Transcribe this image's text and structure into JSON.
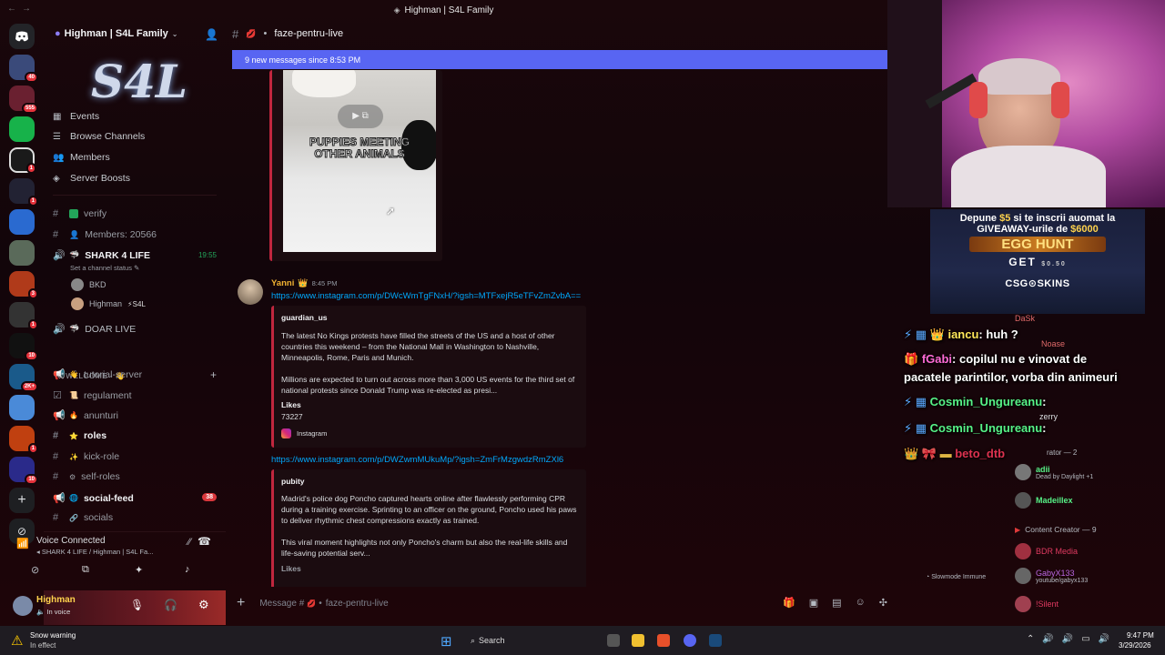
{
  "window": {
    "title": "Highman | S4L Family"
  },
  "server": {
    "name": "Highman | S4L Family",
    "logo_text": "S4L"
  },
  "rail_badges": [
    "40",
    "555",
    "1",
    "1",
    "3",
    "1",
    "10",
    "2K+",
    "1",
    "10"
  ],
  "menu": [
    {
      "label": "Events",
      "icon": "calendar-icon"
    },
    {
      "label": "Browse Channels",
      "icon": "browse-icon"
    },
    {
      "label": "Members",
      "icon": "members-icon"
    },
    {
      "label": "Server Boosts",
      "icon": "boost-icon"
    }
  ],
  "channels_top": [
    {
      "label": "verify",
      "icon": "hash-icon"
    },
    {
      "label": "Members: 20566",
      "icon": "hash-icon"
    }
  ],
  "voice_channel": {
    "name": "SHARK 4 LIFE",
    "timer": "19:55",
    "status_hint": "Set a channel status"
  },
  "voice_users": [
    {
      "name": "BKD"
    },
    {
      "name": "Highman",
      "tag": "S4L"
    }
  ],
  "doar_live": "DOAR LIVE",
  "category": "WELCOME - 👋",
  "channels": [
    {
      "label": "tutorial-server",
      "bold": false
    },
    {
      "label": "regulament",
      "bold": false
    },
    {
      "label": "anunturi",
      "bold": false
    },
    {
      "label": "roles",
      "bold": true
    },
    {
      "label": "kick-role",
      "bold": false
    },
    {
      "label": "self-roles",
      "bold": false
    },
    {
      "label": "social-feed",
      "bold": true,
      "count": "38"
    },
    {
      "label": "socials",
      "bold": false
    }
  ],
  "voice_panel": {
    "status": "Voice Connected",
    "location": "SHARK 4 LIFE / Highman | S4L Fa..."
  },
  "user_panel": {
    "name": "Highman",
    "status": "In voice"
  },
  "chat_header": {
    "channel": "faze-pentru-live"
  },
  "new_messages_bar": "9 new messages since 8:53 PM",
  "video_embed": {
    "caption_line1": "PUPPIES MEETING",
    "caption_line2": "OTHER ANIMALS"
  },
  "message": {
    "author": "Yanni",
    "time": "8:45 PM",
    "link1": "https://www.instagram.com/p/DWcWmTgFNxH/?igsh=MTFxejR5eTFvZmZvbA==",
    "embed1": {
      "account": "guardian_us",
      "para1": "The latest No Kings protests have filled the streets of the US and a host of other countries this weekend – from the National Mall in Washington to Nashville, Minneapolis, Rome, Paris and Munich.",
      "para2": "Millions are expected to turn out across more than 3,000 US events for the third set of national protests since Donald Trump was re-elected as presi...",
      "likes_label": "Likes",
      "likes_value": "73227",
      "footer": "Instagram"
    },
    "link2": "https://www.instagram.com/p/DWZwmMUkuMp/?igsh=ZmFrMzgwdzRmZXl6",
    "embed2": {
      "account": "pubity",
      "para1": "Madrid's police dog Poncho captured hearts online after flawlessly performing CPR during a training exercise. Sprinting to an officer on the ground, Poncho used his paws to deliver rhythmic chest compressions exactly as trained.",
      "para2": "This viral moment highlights not only Poncho's charm but also the real-life skills and life-saving potential serv...",
      "likes_label": "Likes"
    }
  },
  "slowmode": "Slowmode Immune",
  "chat_input": {
    "placeholder_prefix": "Message #",
    "placeholder_channel": "faze-pentru-live"
  },
  "promo": {
    "line1_a": "Depune ",
    "line1_amt": "$5",
    "line1_b": " si te inscrii auomat la",
    "line2_a": "GIVEAWAY-urile de ",
    "line2_amt": "$6000",
    "egg": "EGG HUNT",
    "get": "GET",
    "amount": "$0.50",
    "brand": "CSG⊙SKINS"
  },
  "stream_chat": [
    {
      "user": "iancu",
      "text": "huh ?",
      "color": "#ffe85a"
    },
    {
      "user": "fGabi",
      "text": "copilul nu e vinovat de",
      "color": "#ff6bd6"
    },
    {
      "user": "",
      "text": "pacatele parintilor, vorba din animeuri",
      "color": "#ffffff"
    },
    {
      "user": "Cosmin_Ungureanu",
      "text": "",
      "color": "#57f287"
    },
    {
      "user": "Cosmin_Ungureanu",
      "text": "",
      "color": "#57f287"
    },
    {
      "user": "beto_dtb",
      "text": "",
      "color": "#ff3b5c"
    }
  ],
  "member_list": {
    "names_behind": [
      "DaSk",
      "Noase",
      "zerry"
    ],
    "group1": "rator — 2",
    "members1": [
      {
        "name": "adii",
        "sub": "Dead by Daylight +1"
      },
      {
        "name": "Madeillex",
        "sub": ""
      }
    ],
    "group2": "Content Creator — 9",
    "members2": [
      {
        "name": "BDR Media",
        "sub": "",
        "color": "#e03a60"
      },
      {
        "name": "GabyX133",
        "sub": "youtube/gabyx133",
        "color": "#b866e0"
      },
      {
        "name": "!Silent",
        "sub": "",
        "color": "#e03a60"
      }
    ]
  },
  "taskbar": {
    "weather_title": "Snow warning",
    "weather_sub": "In effect",
    "search": "Search",
    "time": "9:47 PM",
    "date": "3/29/2026"
  },
  "colors": {
    "accent": "#5865f2",
    "link": "#00a8fc",
    "badge": "#da373c",
    "embed_border": "#c0263e"
  }
}
